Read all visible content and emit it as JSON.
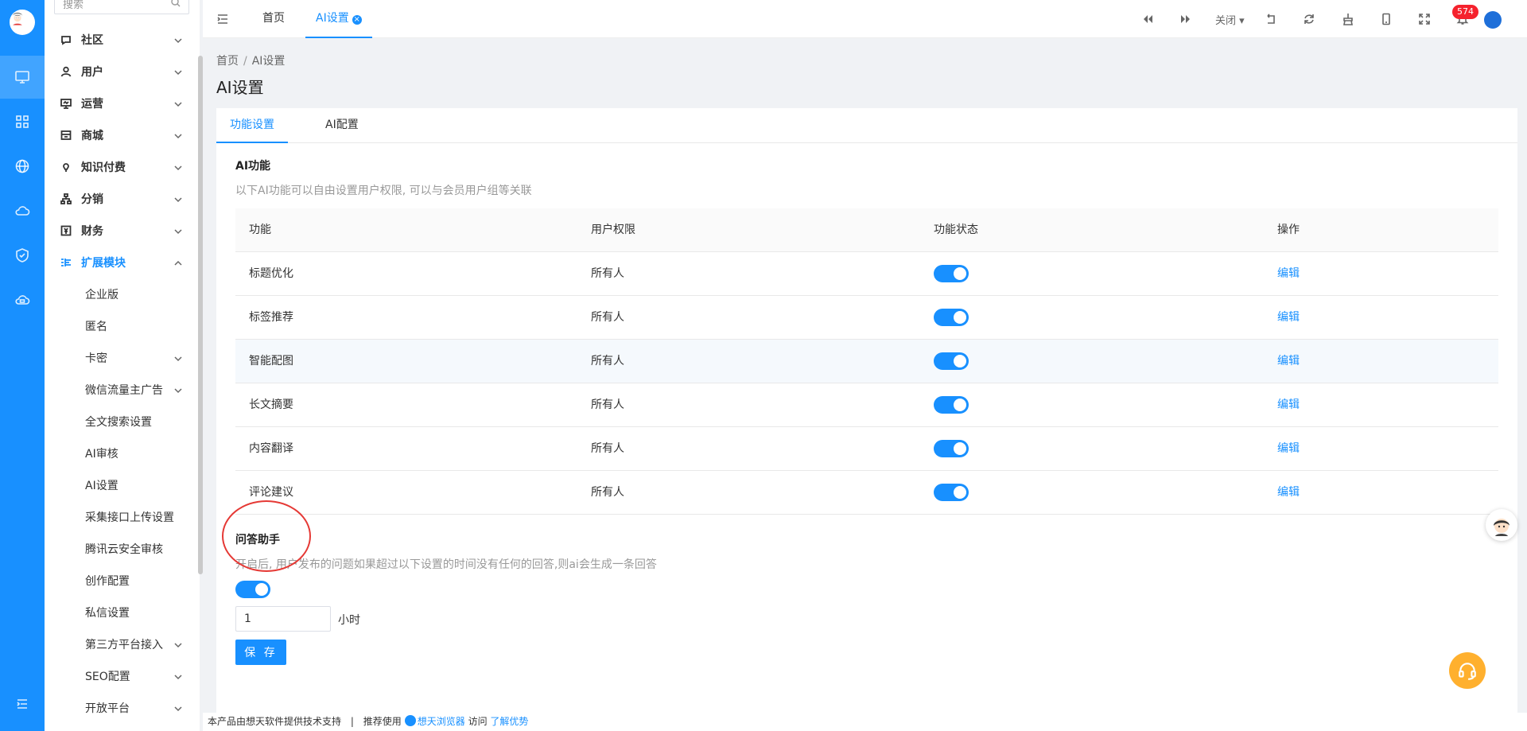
{
  "sidebar_search": {
    "placeholder": "搜索"
  },
  "menu": [
    {
      "label": "社区",
      "icon": "chat-icon"
    },
    {
      "label": "用户",
      "icon": "user-icon"
    },
    {
      "label": "运营",
      "icon": "monitor-icon"
    },
    {
      "label": "商城",
      "icon": "store-icon"
    },
    {
      "label": "知识付费",
      "icon": "bulb-icon"
    },
    {
      "label": "分销",
      "icon": "network-icon"
    },
    {
      "label": "财务",
      "icon": "finance-icon"
    },
    {
      "label": "扩展模块",
      "icon": "extension-icon"
    }
  ],
  "submenu": [
    {
      "label": "企业版"
    },
    {
      "label": "匿名"
    },
    {
      "label": "卡密"
    },
    {
      "label": "微信流量主广告"
    },
    {
      "label": "全文搜索设置"
    },
    {
      "label": "AI审核"
    },
    {
      "label": "AI设置"
    },
    {
      "label": "采集接口上传设置"
    },
    {
      "label": "腾讯云安全审核"
    },
    {
      "label": "创作配置"
    },
    {
      "label": "私信设置"
    },
    {
      "label": "第三方平台接入"
    },
    {
      "label": "SEO配置"
    },
    {
      "label": "开放平台"
    }
  ],
  "topbar": {
    "tabs": [
      "首页",
      "AI设置"
    ],
    "close_label": "关闭",
    "notification_count": "574"
  },
  "breadcrumb": {
    "home": "首页",
    "current": "AI设置"
  },
  "page_title": "AI设置",
  "content_tabs": [
    "功能设置",
    "AI配置"
  ],
  "ai_section": {
    "title": "AI功能",
    "description": "以下AI功能可以自由设置用户权限, 可以与会员用户组等关联"
  },
  "table": {
    "headers": [
      "功能",
      "用户权限",
      "功能状态",
      "操作"
    ],
    "rows": [
      {
        "feature": "标题优化",
        "permission": "所有人",
        "enabled": true,
        "action": "编辑"
      },
      {
        "feature": "标签推荐",
        "permission": "所有人",
        "enabled": true,
        "action": "编辑"
      },
      {
        "feature": "智能配图",
        "permission": "所有人",
        "enabled": true,
        "action": "编辑"
      },
      {
        "feature": "长文摘要",
        "permission": "所有人",
        "enabled": true,
        "action": "编辑"
      },
      {
        "feature": "内容翻译",
        "permission": "所有人",
        "enabled": true,
        "action": "编辑"
      },
      {
        "feature": "评论建议",
        "permission": "所有人",
        "enabled": true,
        "action": "编辑"
      }
    ]
  },
  "qa_section": {
    "title": "问答助手",
    "description": "开启后, 用户发布的问题如果超过以下设置的时间没有任何的回答,则ai会生成一条回答",
    "enabled": true,
    "hours_value": "1",
    "unit": "小时",
    "save_label": "保 存"
  },
  "footer": {
    "text1": "本产品由想天软件提供技术支持",
    "sep": "|",
    "text2": "推荐使用",
    "browser_link": "想天浏览器",
    "text3": "访问",
    "learn_link": "了解优势"
  },
  "colors": {
    "primary": "#1890ff",
    "badge": "#f5222d",
    "help": "#ffb02e",
    "highlight_circle": "#e53935"
  }
}
